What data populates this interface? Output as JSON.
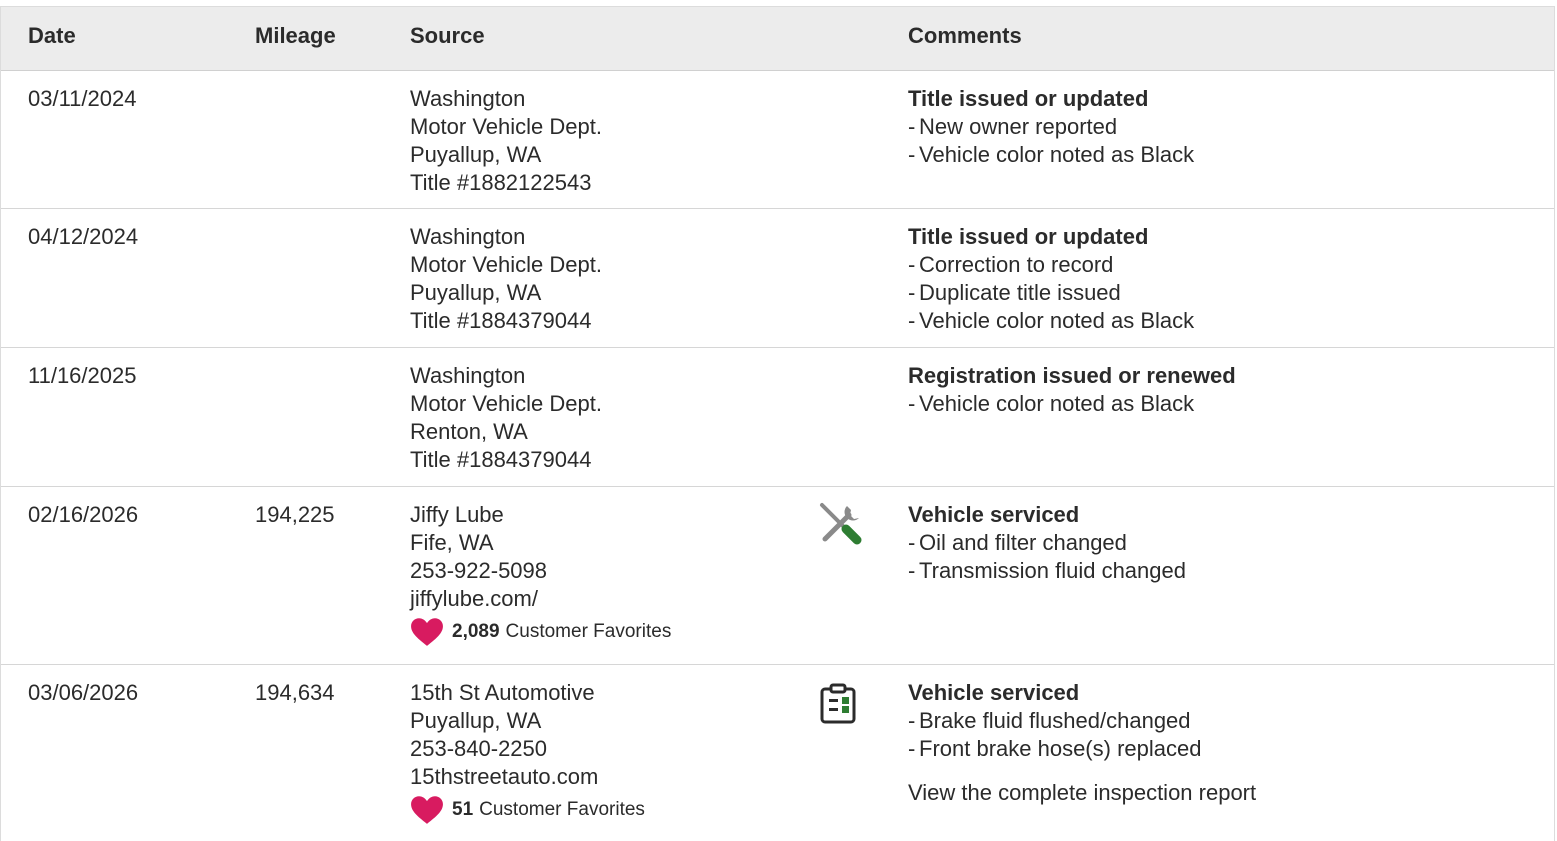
{
  "columns": {
    "date": "Date",
    "mileage": "Mileage",
    "source": "Source",
    "comments": "Comments"
  },
  "rows": [
    {
      "date": "03/11/2024",
      "mileage": "",
      "source": [
        "Washington",
        "Motor Vehicle Dept.",
        "Puyallup, WA",
        "Title #1882122543"
      ],
      "icon": "",
      "comment_title": "Title issued or updated",
      "comments": [
        "New owner reported",
        "Vehicle color noted as Black"
      ]
    },
    {
      "date": "04/12/2024",
      "mileage": "",
      "source": [
        "Washington",
        "Motor Vehicle Dept.",
        "Puyallup, WA",
        "Title #1884379044"
      ],
      "icon": "",
      "comment_title": "Title issued or updated",
      "comments": [
        "Correction to record",
        "Duplicate title issued",
        "Vehicle color noted as Black"
      ]
    },
    {
      "date": "11/16/2025",
      "mileage": "",
      "source": [
        "Washington",
        "Motor Vehicle Dept.",
        "Renton, WA",
        "Title #1884379044"
      ],
      "icon": "",
      "comment_title": "Registration issued or renewed",
      "comments": [
        "Vehicle color noted as Black"
      ]
    },
    {
      "date": "02/16/2026",
      "mileage": "194,225",
      "source": [
        "Jiffy Lube",
        "Fife, WA",
        "253-922-5098",
        "jiffylube.com/"
      ],
      "favorites_count": "2,089",
      "favorites_label": "Customer Favorites",
      "icon": "wrench-screwdriver-icon",
      "comment_title": "Vehicle serviced",
      "comments": [
        "Oil and filter changed",
        "Transmission fluid changed"
      ]
    },
    {
      "date": "03/06/2026",
      "mileage": "194,634",
      "source": [
        "15th St Automotive",
        "Puyallup, WA",
        "253-840-2250",
        "15thstreetauto.com"
      ],
      "favorites_count": "51",
      "favorites_label": "Customer Favorites",
      "icon": "clipboard-icon",
      "comment_title": "Vehicle serviced",
      "comments": [
        "Brake fluid flushed/changed",
        "Front brake hose(s) replaced"
      ],
      "link": "View the complete inspection report"
    }
  ],
  "bullet_dash": "-",
  "colors": {
    "header_bg": "#ececec",
    "heart": "#d81b60",
    "icon_gray": "#8a8a8a",
    "icon_green": "#2e7d32",
    "text": "#2b2b2b"
  }
}
